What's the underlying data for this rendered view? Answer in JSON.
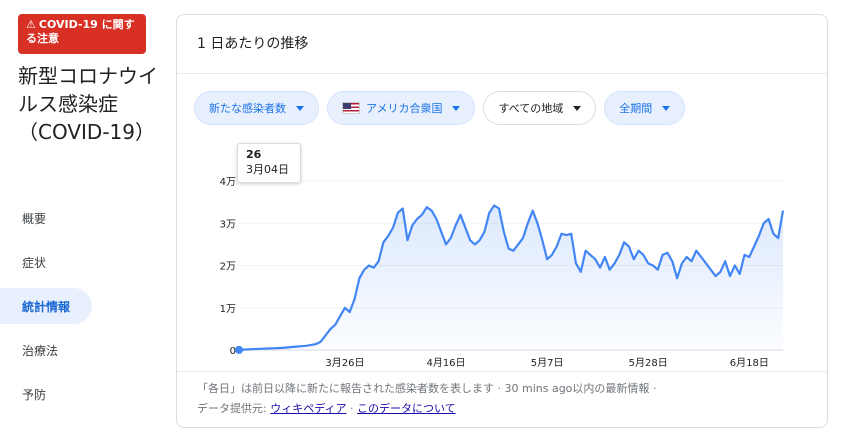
{
  "sidebar": {
    "warning": {
      "icon": "warning-triangle-icon",
      "text": "COVID-19 に関する注意"
    },
    "title": "新型コロナウイルス感染症（COVID-19）",
    "nav": [
      {
        "label": "概要",
        "active": false
      },
      {
        "label": "症状",
        "active": false
      },
      {
        "label": "統計情報",
        "active": true
      },
      {
        "label": "治療法",
        "active": false
      },
      {
        "label": "予防",
        "active": false
      }
    ]
  },
  "card": {
    "title": "1 日あたりの推移",
    "filters": [
      {
        "label": "新たな感染者数",
        "style": "blue"
      },
      {
        "label": "アメリカ合衆国",
        "style": "blue",
        "icon": "us-flag-icon"
      },
      {
        "label": "すべての地域",
        "style": "plain"
      },
      {
        "label": "全期間",
        "style": "blue"
      }
    ],
    "tooltip": {
      "value": "26",
      "date": "3月04日"
    },
    "footer": {
      "line1": "「各日」は前日以降に新たに報告された感染者数を表します · 30 mins ago以内の最新情報 ·",
      "source_label": "データ提供元:",
      "source_link": "ウィキペディア",
      "separator": "·",
      "about_link": "このデータについて"
    }
  },
  "colors": {
    "accent": "#1a73e8",
    "line": "#4285f4",
    "warning": "#d93025"
  },
  "chart_data": {
    "type": "area",
    "yticks": [
      "0",
      "1万",
      "2万",
      "3万",
      "4万"
    ],
    "ytick_values": [
      0,
      10000,
      20000,
      30000,
      40000
    ],
    "xticks": [
      "3月26日",
      "4月16日",
      "5月7日",
      "5月28日",
      "6月18日"
    ],
    "x_start": "3月04日",
    "ylim": [
      0,
      40000
    ],
    "series": [
      {
        "values": [
          26,
          100,
          150,
          200,
          250,
          300,
          350,
          400,
          450,
          500,
          600,
          700,
          800,
          900,
          1000,
          1200,
          1400,
          2000,
          3500,
          5000,
          6000,
          8000,
          10000,
          9000,
          12000,
          17000,
          19000,
          20000,
          19500,
          21000,
          25500,
          27000,
          29000,
          32500,
          33500,
          26000,
          29500,
          31000,
          32000,
          33800,
          33000,
          31000,
          28000,
          25000,
          26500,
          29500,
          32000,
          29000,
          26000,
          25000,
          26000,
          28000,
          32500,
          34200,
          33500,
          28000,
          24000,
          23500,
          25000,
          26500,
          30000,
          33000,
          30000,
          26000,
          21500,
          22500,
          24500,
          27500,
          27200,
          27500,
          20500,
          18500,
          23500,
          22500,
          21500,
          19500,
          22000,
          19000,
          20500,
          22500,
          25500,
          24500,
          21500,
          23500,
          22500,
          20500,
          20000,
          19000,
          22500,
          23000,
          21000,
          17000,
          20500,
          22000,
          21000,
          23500,
          22000,
          20500,
          19000,
          17500,
          18500,
          21000,
          17500,
          20000,
          18000,
          22500,
          22000,
          24500,
          27000,
          30000,
          31000,
          27500,
          26500,
          33000
        ]
      }
    ]
  }
}
